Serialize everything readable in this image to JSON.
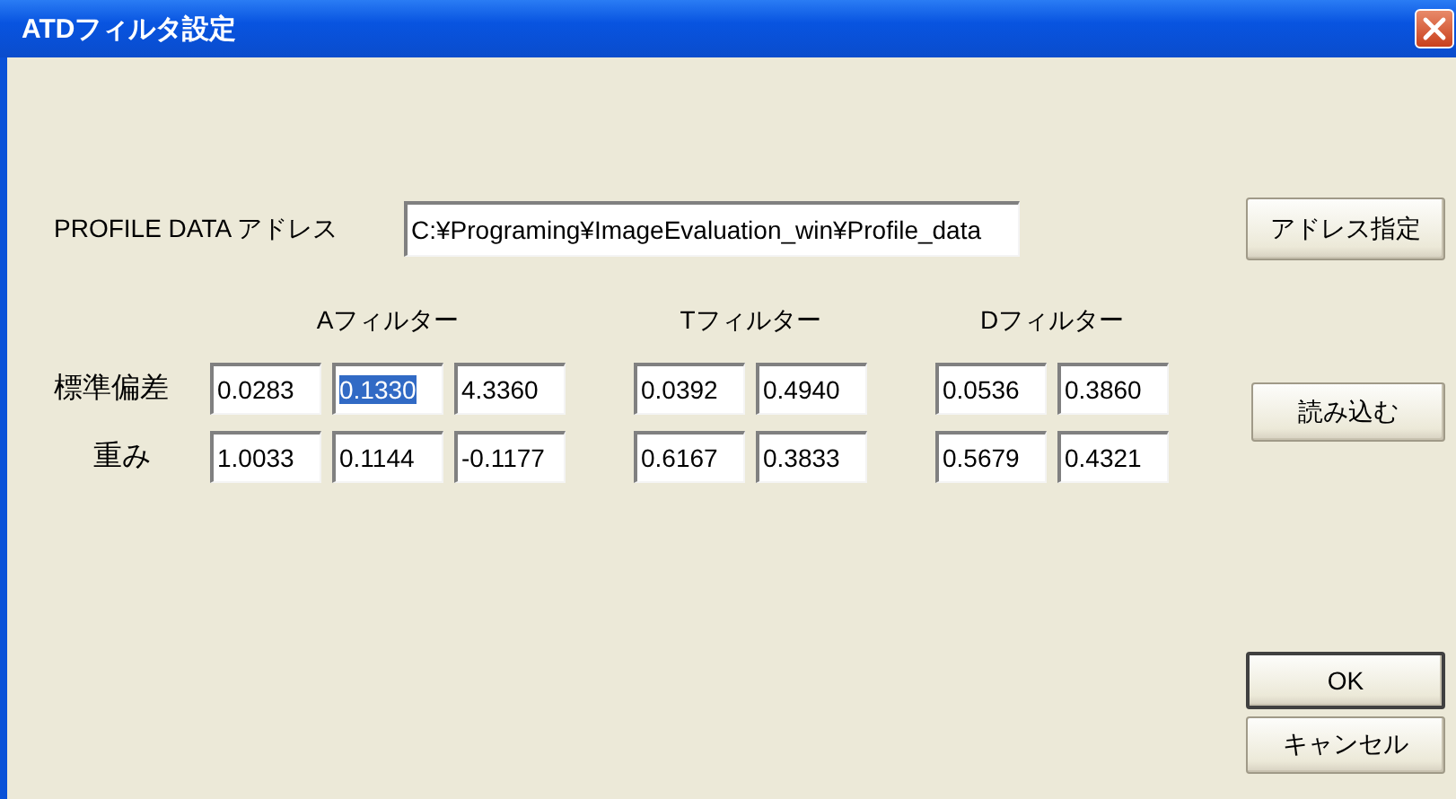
{
  "window": {
    "title": "ATDフィルタ設定"
  },
  "address": {
    "label": "PROFILE DATA アドレス",
    "value": "C:¥Programing¥ImageEvaluation_win¥Profile_data",
    "button": "アドレス指定"
  },
  "row_labels": [
    "標準偏差",
    "重み"
  ],
  "filters": [
    {
      "title": "Aフィルター",
      "rows": [
        [
          {
            "value": "0.0283",
            "selected": false
          },
          {
            "value": "0.1330",
            "selected": true
          },
          {
            "value": "4.3360",
            "selected": false
          }
        ],
        [
          {
            "value": "1.0033",
            "selected": false
          },
          {
            "value": "0.1144",
            "selected": false
          },
          {
            "value": "-0.1177",
            "selected": false
          }
        ]
      ]
    },
    {
      "title": "Tフィルター",
      "rows": [
        [
          {
            "value": "0.0392",
            "selected": false
          },
          {
            "value": "0.4940",
            "selected": false
          }
        ],
        [
          {
            "value": "0.6167",
            "selected": false
          },
          {
            "value": "0.3833",
            "selected": false
          }
        ]
      ]
    },
    {
      "title": "Dフィルター",
      "rows": [
        [
          {
            "value": "0.0536",
            "selected": false
          },
          {
            "value": "0.3860",
            "selected": false
          }
        ],
        [
          {
            "value": "0.5679",
            "selected": false
          },
          {
            "value": "0.4321",
            "selected": false
          }
        ]
      ]
    }
  ],
  "load_button": "読み込む",
  "buttons": [
    {
      "label": "OK",
      "default": true
    },
    {
      "label": "キャンセル",
      "default": false
    }
  ]
}
